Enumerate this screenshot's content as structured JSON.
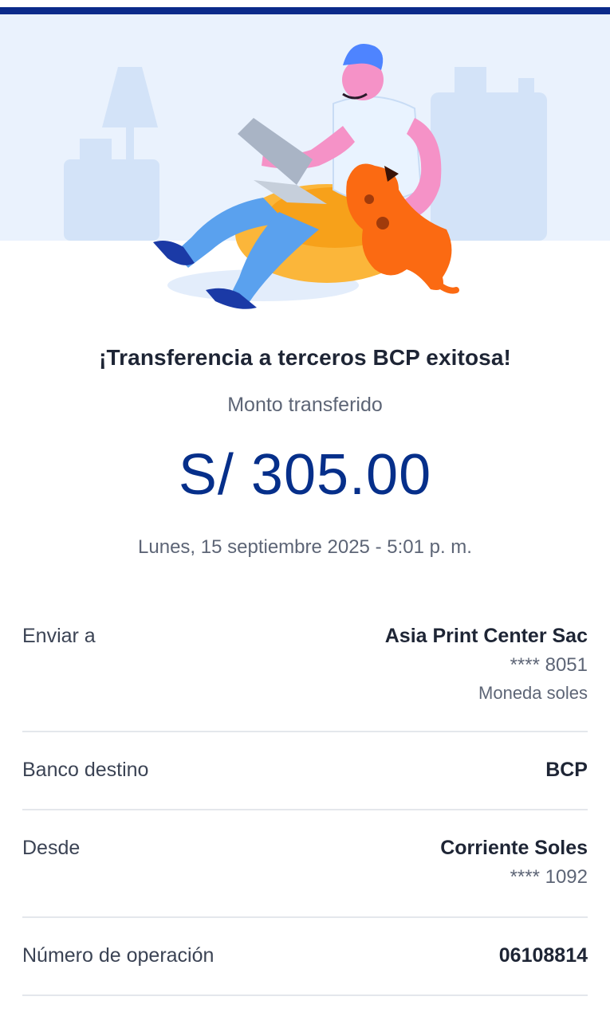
{
  "header": {
    "accent_color": "#0b2a8a",
    "illustration": "person-with-laptop-and-dog-illustration"
  },
  "confirmation": {
    "title": "¡Transferencia a terceros BCP exitosa!",
    "subtitle": "Monto transferido",
    "amount": "S/ 305.00",
    "datetime": "Lunes, 15 septiembre 2025 - 5:01 p. m."
  },
  "details": {
    "enviar_a": {
      "label": "Enviar a",
      "name": "Asia Print Center Sac",
      "account": "**** 8051",
      "currency": "Moneda soles"
    },
    "banco_destino": {
      "label": "Banco destino",
      "value": "BCP"
    },
    "desde": {
      "label": "Desde",
      "account_type": "Corriente Soles",
      "account": "**** 1092"
    },
    "numero_operacion": {
      "label": "Número de operación",
      "value": "06108814"
    }
  },
  "colors": {
    "amount": "#062f8a",
    "hero_background": "#eaf2fd",
    "divider": "#e4e7ec"
  }
}
